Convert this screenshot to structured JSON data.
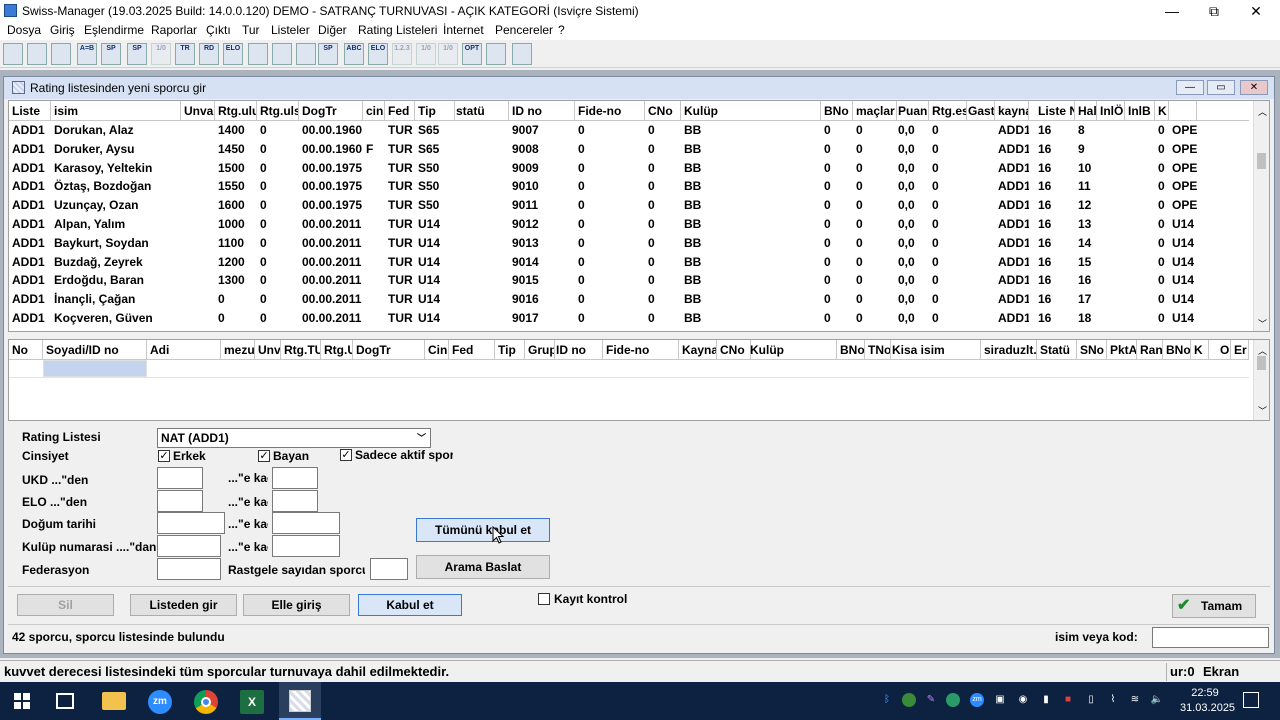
{
  "app": {
    "title": "Swiss-Manager (19.03.2025 Build: 14.0.0.120)  DEMO - SATRANÇ TURNUVASI  - AÇIK KATEGORİ  (Isviçre Sistemi)",
    "minimize": "—",
    "maximize": "⧉",
    "close": "✕"
  },
  "menu": [
    "Dosya",
    "Giriş",
    "Eşlendirme",
    "Raporlar",
    "Çıktı",
    "Tur",
    "Listeler",
    "Diğer",
    "Rating Listeleri",
    "İnternet",
    "Pencereler",
    "?"
  ],
  "toolbar": [
    "",
    "",
    "",
    "A=B",
    "SP",
    "SP",
    "1/0",
    "TR",
    "RD",
    "ELO",
    "",
    "",
    "",
    "SP",
    "ABC",
    "ELO",
    "1.2.3",
    "1/0",
    "1/0",
    "OPT",
    "",
    ""
  ],
  "child": {
    "title": "Rating listesinden yeni sporcu gir"
  },
  "grid1": {
    "headers": [
      "Liste",
      "isim",
      "Unvan",
      "Rtg.ulus",
      "Rtg.ulsl",
      "DogTr",
      "cins",
      "Fed",
      "Tip",
      "statü",
      "ID no",
      "Fide-no",
      "CNo",
      "Kulüp",
      "BNo",
      "maçlar",
      "Puan",
      "Rtg.esl",
      "Gast",
      "kaynak",
      "Liste No",
      "Hal",
      "InlÖ",
      "InlB",
      "K",
      ""
    ],
    "rows": [
      [
        "ADD1",
        "Dorukan, Alaz",
        "",
        "1400",
        "0",
        "00.00.1960",
        "",
        "TUR",
        "S65",
        "",
        "9007",
        "0",
        "0",
        "BB",
        "0",
        "0",
        "0,0",
        "0",
        "",
        "ADD1",
        "16",
        "8",
        "",
        "",
        "0",
        "OPEN"
      ],
      [
        "ADD1",
        "Doruker, Aysu",
        "",
        "1450",
        "0",
        "00.00.1960",
        "F",
        "TUR",
        "S65",
        "",
        "9008",
        "0",
        "0",
        "BB",
        "0",
        "0",
        "0,0",
        "0",
        "",
        "ADD1",
        "16",
        "9",
        "",
        "",
        "0",
        "OPEN"
      ],
      [
        "ADD1",
        "Karasoy, Yeltekin",
        "",
        "1500",
        "0",
        "00.00.1975",
        "",
        "TUR",
        "S50",
        "",
        "9009",
        "0",
        "0",
        "BB",
        "0",
        "0",
        "0,0",
        "0",
        "",
        "ADD1",
        "16",
        "10",
        "",
        "",
        "0",
        "OPEN"
      ],
      [
        "ADD1",
        "Öztaş, Bozdoğan",
        "",
        "1550",
        "0",
        "00.00.1975",
        "",
        "TUR",
        "S50",
        "",
        "9010",
        "0",
        "0",
        "BB",
        "0",
        "0",
        "0,0",
        "0",
        "",
        "ADD1",
        "16",
        "11",
        "",
        "",
        "0",
        "OPEN"
      ],
      [
        "ADD1",
        "Uzunçay, Ozan",
        "",
        "1600",
        "0",
        "00.00.1975",
        "",
        "TUR",
        "S50",
        "",
        "9011",
        "0",
        "0",
        "BB",
        "0",
        "0",
        "0,0",
        "0",
        "",
        "ADD1",
        "16",
        "12",
        "",
        "",
        "0",
        "OPEN"
      ],
      [
        "ADD1",
        "Alpan, Yalım",
        "",
        "1000",
        "0",
        "00.00.2011",
        "",
        "TUR",
        "U14",
        "",
        "9012",
        "0",
        "0",
        "BB",
        "0",
        "0",
        "0,0",
        "0",
        "",
        "ADD1",
        "16",
        "13",
        "",
        "",
        "0",
        "U14"
      ],
      [
        "ADD1",
        "Baykurt, Soydan",
        "",
        "1100",
        "0",
        "00.00.2011",
        "",
        "TUR",
        "U14",
        "",
        "9013",
        "0",
        "0",
        "BB",
        "0",
        "0",
        "0,0",
        "0",
        "",
        "ADD1",
        "16",
        "14",
        "",
        "",
        "0",
        "U14"
      ],
      [
        "ADD1",
        "Buzdağ, Zeyrek",
        "",
        "1200",
        "0",
        "00.00.2011",
        "",
        "TUR",
        "U14",
        "",
        "9014",
        "0",
        "0",
        "BB",
        "0",
        "0",
        "0,0",
        "0",
        "",
        "ADD1",
        "16",
        "15",
        "",
        "",
        "0",
        "U14"
      ],
      [
        "ADD1",
        "Erdoğdu, Baran",
        "",
        "1300",
        "0",
        "00.00.2011",
        "",
        "TUR",
        "U14",
        "",
        "9015",
        "0",
        "0",
        "BB",
        "0",
        "0",
        "0,0",
        "0",
        "",
        "ADD1",
        "16",
        "16",
        "",
        "",
        "0",
        "U14"
      ],
      [
        "ADD1",
        "İnançli, Çağan",
        "",
        "0",
        "0",
        "00.00.2011",
        "",
        "TUR",
        "U14",
        "",
        "9016",
        "0",
        "0",
        "BB",
        "0",
        "0",
        "0,0",
        "0",
        "",
        "ADD1",
        "16",
        "17",
        "",
        "",
        "0",
        "U14"
      ],
      [
        "ADD1",
        "Koçveren, Güven",
        "",
        "0",
        "0",
        "00.00.2011",
        "",
        "TUR",
        "U14",
        "",
        "9017",
        "0",
        "0",
        "BB",
        "0",
        "0",
        "0,0",
        "0",
        "",
        "ADD1",
        "16",
        "18",
        "",
        "",
        "0",
        "U14"
      ]
    ]
  },
  "grid2": {
    "headers": [
      "No",
      "Soyadi/ID no",
      "Adi",
      "mezun",
      "Unvan",
      "Rtg.TUR",
      "Rtg.Ulus",
      "DogTr",
      "Cins",
      "Fed",
      "Tip",
      "Grup",
      "ID no",
      "Fide-no",
      "Kaynak",
      "CNo",
      "Kulüp",
      "BNo",
      "TNo",
      "Kisa isim",
      "siraduzlt.",
      "Statü",
      "SNo",
      "PktA",
      "Rank",
      "BNoR",
      "K",
      "Or",
      "Er"
    ]
  },
  "form": {
    "rating_label": "Rating Listesi",
    "rating_value": "NAT (ADD1)",
    "cins_label": "Cinsiyet",
    "erkek": "Erkek",
    "bayan": "Bayan",
    "aktif": "Sadece aktif sporcu",
    "ukd_label": "UKD ...\"den",
    "elo_label": "ELO ...\"den",
    "dogum_label": "Doğum tarihi",
    "kulup_label": "Kulüp numarasi ....\"dan",
    "fed_label": "Federasyon",
    "eka": "...\"e kadar",
    "random_label": "Rastgele sayıdan sporcular",
    "accept_all": "Tümünü kabul et",
    "search": "Arama Baslat"
  },
  "buttons": {
    "sil": "Sil",
    "listeden": "Listeden gir",
    "elle": "Elle giriş",
    "kabul": "Kabul et",
    "kayit": "Kayıt kontrol",
    "tamam": "Tamam"
  },
  "info": {
    "count": "42 sporcu, sporcu listesinde bulundu",
    "search_label": "isim veya kod:"
  },
  "status": {
    "message": "kuvvet derecesi listesindeki tüm sporcular turnuvaya dahil edilmektedir.",
    "tur": "ur:0",
    "ekran": "Ekran"
  },
  "taskbar": {
    "time": "22:59",
    "date": "31.03.2025"
  },
  "colors": {
    "accent": "#3a78d4",
    "taskbar": "#0d2240",
    "ok": "#1a8a2a"
  }
}
